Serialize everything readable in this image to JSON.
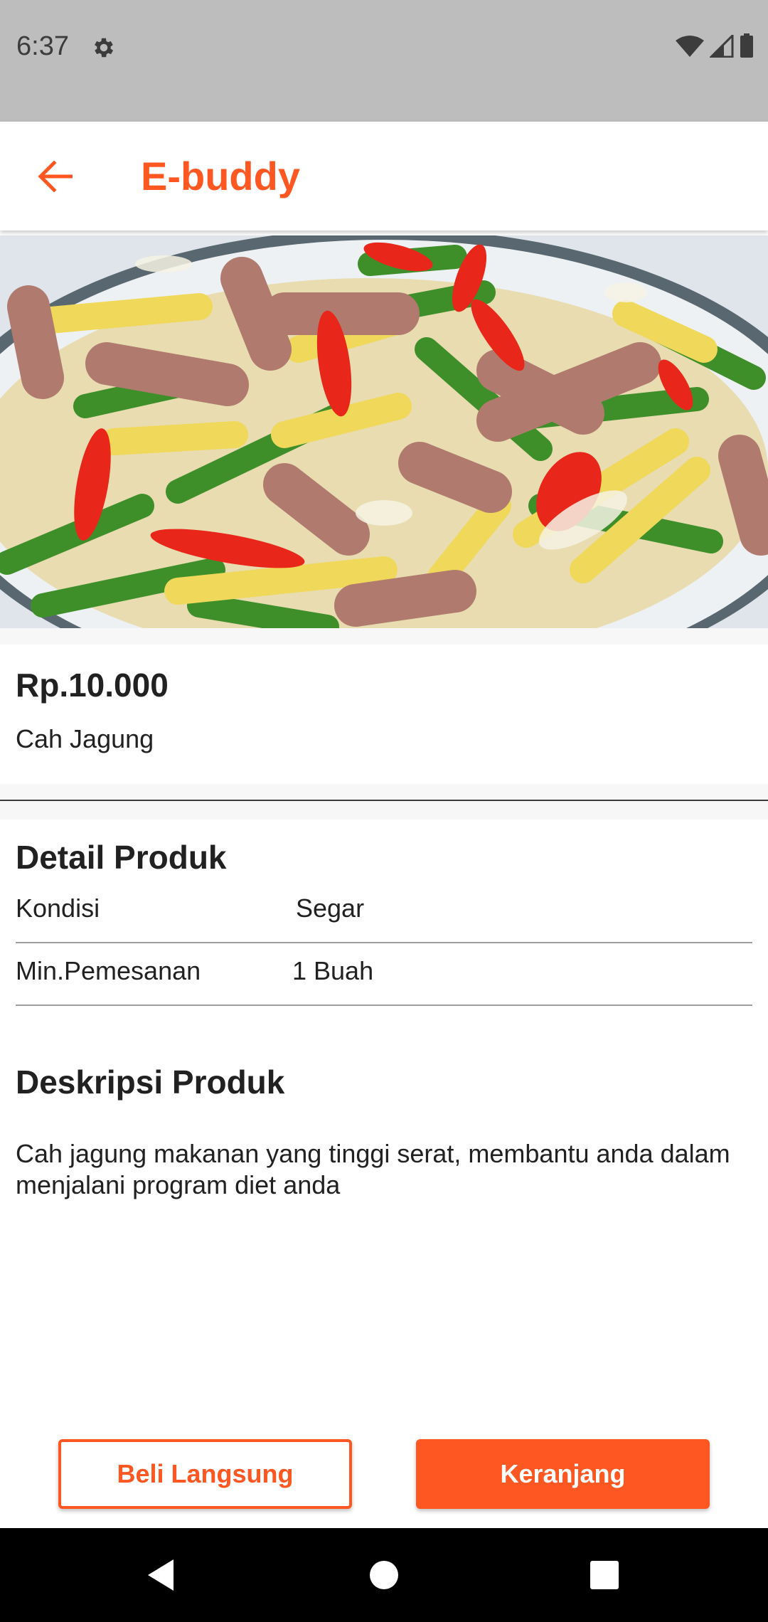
{
  "status_bar": {
    "time": "6:37",
    "icons": [
      "gear-icon",
      "wifi-icon",
      "signal-icon",
      "battery-icon"
    ]
  },
  "app_bar": {
    "title": "E-buddy",
    "back_icon": "arrow-left-icon",
    "accent_color": "#ff5722"
  },
  "product": {
    "image_icon": "food-photo",
    "price": "Rp.10.000",
    "name": "Cah Jagung"
  },
  "detail": {
    "title": "Detail Produk",
    "rows": [
      {
        "label": "Kondisi",
        "value": "Segar"
      },
      {
        "label": "Min.Pemesanan",
        "value": "1 Buah"
      }
    ]
  },
  "description": {
    "title": "Deskripsi Produk",
    "text": "Cah jagung makanan yang tinggi serat, membantu anda dalam menjalani program diet anda"
  },
  "actions": {
    "buy_now_label": "Beli Langsung",
    "cart_label": "Keranjang"
  },
  "nav_bar": {
    "icons": [
      "back-triangle-icon",
      "home-circle-icon",
      "recents-square-icon"
    ]
  }
}
